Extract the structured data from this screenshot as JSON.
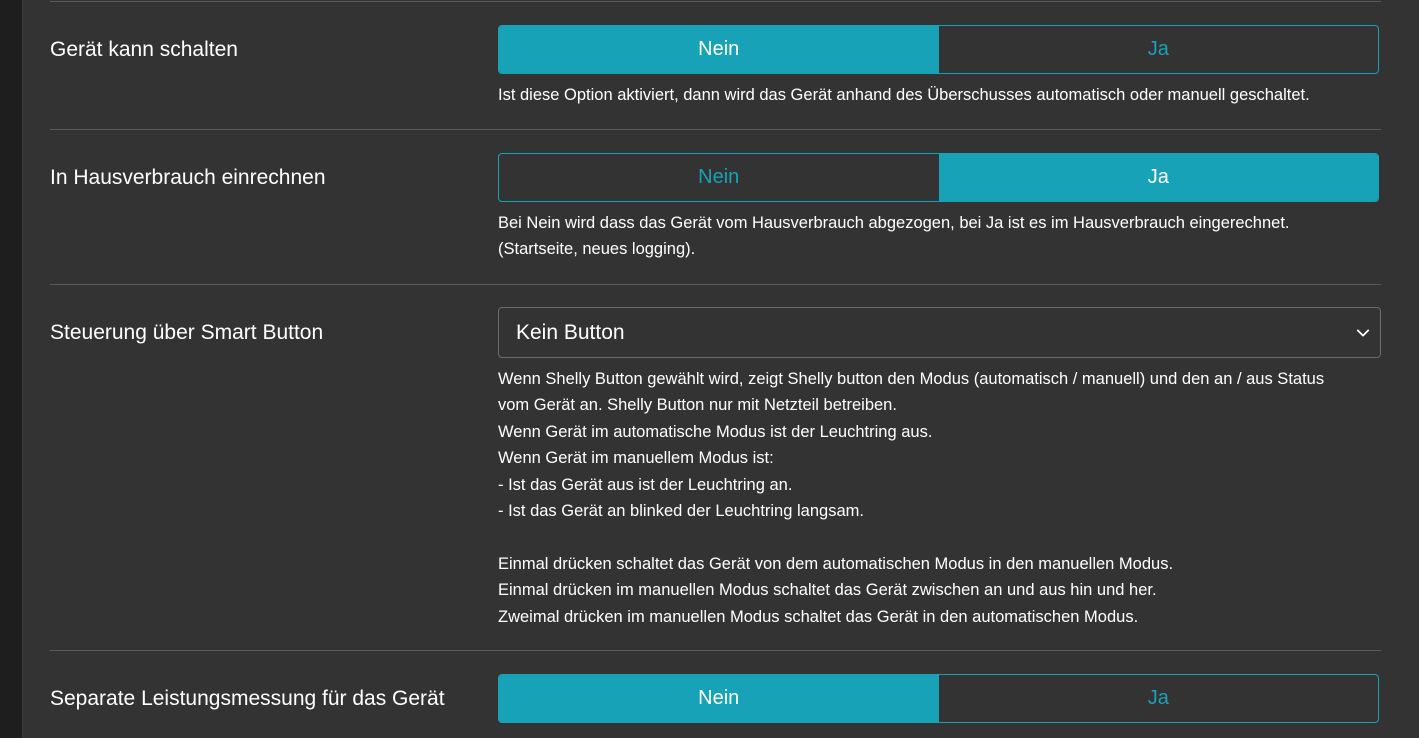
{
  "settings": [
    {
      "label": "Gerät kann schalten",
      "options": [
        "Nein",
        "Ja"
      ],
      "selected": "Nein",
      "help": [
        "Ist diese Option aktiviert, dann wird das Gerät anhand des Überschusses automatisch oder manuell geschaltet."
      ]
    },
    {
      "label": "In Hausverbrauch einrechnen",
      "options": [
        "Nein",
        "Ja"
      ],
      "selected": "Ja",
      "help": [
        "Bei Nein wird dass das Gerät vom Hausverbrauch abgezogen, bei Ja ist es im Hausverbrauch eingerechnet.",
        "(Startseite, neues logging)."
      ]
    },
    {
      "label": "Steuerung über Smart Button",
      "select_value": "Kein Button",
      "help": [
        "Wenn Shelly Button gewählt wird, zeigt Shelly button den Modus (automatisch / manuell) und den an / aus Status",
        "vom Gerät an. Shelly Button nur mit Netzteil betreiben.",
        "Wenn Gerät im automatische Modus ist der Leuchtring aus.",
        "Wenn Gerät im manuellem Modus ist:",
        "- Ist das Gerät aus ist der Leuchtring an.",
        "- Ist das Gerät an blinked der Leuchtring langsam.",
        "",
        "Einmal drücken schaltet das Gerät von dem automatischen Modus in den manuellen Modus.",
        "Einmal drücken im manuellen Modus schaltet das Gerät zwischen an und aus hin und her.",
        "Zweimal drücken im manuellen Modus schaltet das Gerät in den automatischen Modus."
      ]
    },
    {
      "label": "Separate Leistungsmessung für das Gerät",
      "options": [
        "Nein",
        "Ja"
      ],
      "selected": "Nein"
    }
  ],
  "colors": {
    "accent": "#17a2b8",
    "background": "#333333",
    "divider": "#5a5a5a"
  },
  "icons": {
    "select_arrow": "chevron-down-icon"
  }
}
